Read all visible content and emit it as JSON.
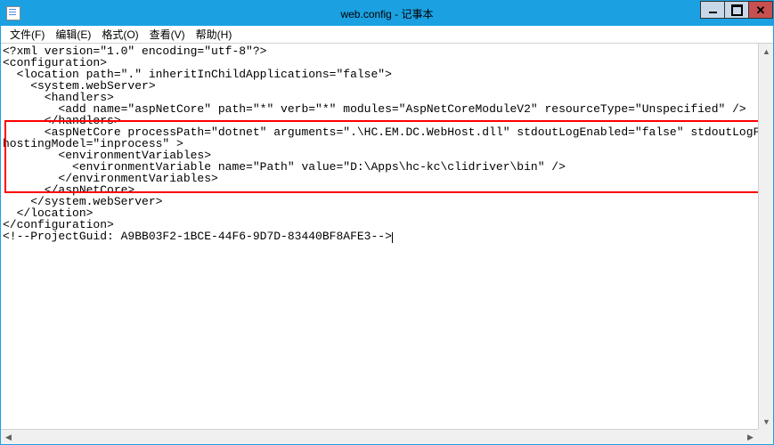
{
  "window": {
    "title": "web.config - 记事本"
  },
  "menubar": {
    "items": [
      {
        "label": "文件(F)"
      },
      {
        "label": "编辑(E)"
      },
      {
        "label": "格式(O)"
      },
      {
        "label": "查看(V)"
      },
      {
        "label": "帮助(H)"
      }
    ]
  },
  "content": {
    "lines": [
      "<?xml version=\"1.0\" encoding=\"utf-8\"?>",
      "<configuration>",
      "  <location path=\".\" inheritInChildApplications=\"false\">",
      "    <system.webServer>",
      "      <handlers>",
      "        <add name=\"aspNetCore\" path=\"*\" verb=\"*\" modules=\"AspNetCoreModuleV2\" resourceType=\"Unspecified\" />",
      "      </handlers>",
      "      <aspNetCore processPath=\"dotnet\" arguments=\".\\HC.EM.DC.WebHost.dll\" stdoutLogEnabled=\"false\" stdoutLogFile=\".\\logs\\stdout\" ",
      "hostingModel=\"inprocess\" >",
      "        <environmentVariables>",
      "          <environmentVariable name=\"Path\" value=\"D:\\Apps\\hc-kc\\clidriver\\bin\" />",
      "        </environmentVariables>",
      "      </aspNetCore>",
      "    </system.webServer>",
      "  </location>",
      "</configuration>",
      "<!--ProjectGuid: A9BB03F2-1BCE-44F6-9D7D-83440BF8AFE3-->"
    ]
  },
  "icons": {
    "arrow_up": "▲",
    "arrow_down": "▼",
    "arrow_left": "◀",
    "arrow_right": "▶",
    "close_x": "✕"
  }
}
